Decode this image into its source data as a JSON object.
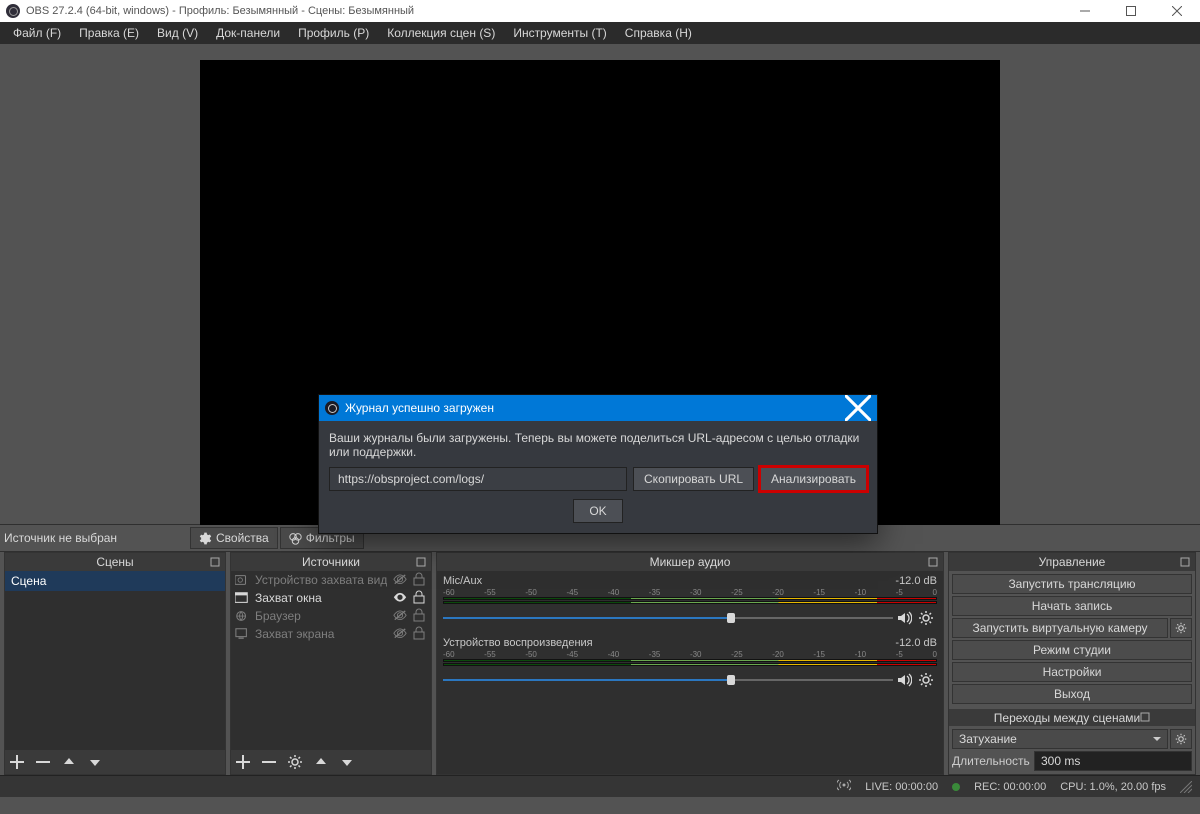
{
  "window": {
    "title": "OBS 27.2.4 (64-bit, windows) - Профиль: Безымянный - Сцены: Безымянный"
  },
  "menu": {
    "file": "Файл (F)",
    "edit": "Правка (E)",
    "view": "Вид (V)",
    "docks": "Док-панели",
    "profile": "Профиль (P)",
    "scene_collection": "Коллекция сцен (S)",
    "tools": "Инструменты (T)",
    "help": "Справка (H)"
  },
  "source_props": {
    "no_source": "Источник не выбран",
    "properties": "Свойства",
    "filters": "Фильтры"
  },
  "docks": {
    "scenes": "Сцены",
    "sources": "Источники",
    "mixer": "Микшер аудио",
    "controls": "Управление",
    "transitions": "Переходы между сценами"
  },
  "scenes": {
    "items": [
      "Сцена"
    ]
  },
  "sources": {
    "items": [
      {
        "name": "Устройство захвата видео",
        "visible": false,
        "active": false
      },
      {
        "name": "Захват окна",
        "visible": true,
        "active": true
      },
      {
        "name": "Браузер",
        "visible": false,
        "active": false
      },
      {
        "name": "Захват экрана",
        "visible": false,
        "active": false
      }
    ]
  },
  "mixer": {
    "db_label": "-12.0 dB",
    "channels": [
      {
        "name": "Mic/Aux",
        "db": "-12.0 dB",
        "slider_pct": 64
      },
      {
        "name": "Устройство воспроизведения",
        "db": "-12.0 dB",
        "slider_pct": 64
      }
    ],
    "ticks": [
      "-60",
      "-55",
      "-50",
      "-45",
      "-40",
      "-35",
      "-30",
      "-25",
      "-20",
      "-15",
      "-10",
      "-5",
      "0"
    ]
  },
  "controls": {
    "start_streaming": "Запустить трансляцию",
    "start_recording": "Начать запись",
    "start_virtual_cam": "Запустить виртуальную камеру",
    "studio_mode": "Режим студии",
    "settings": "Настройки",
    "exit": "Выход"
  },
  "transitions": {
    "fade": "Затухание",
    "duration_label": "Длительность",
    "duration_value": "300 ms"
  },
  "statusbar": {
    "live": "LIVE: 00:00:00",
    "rec": "REC: 00:00:00",
    "cpu": "CPU: 1.0%, 20.00 fps"
  },
  "dialog": {
    "title": "Журнал успешно загружен",
    "message": "Ваши журналы были загружены. Теперь вы можете поделиться URL-адресом с целью отладки или поддержки.",
    "url": "https://obsproject.com/logs/",
    "copy": "Скопировать URL",
    "analyze": "Анализировать",
    "ok": "OK"
  }
}
